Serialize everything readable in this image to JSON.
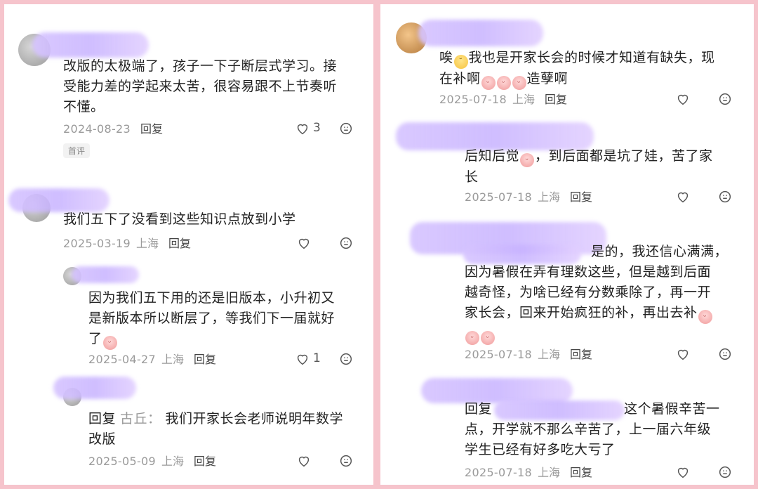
{
  "left": {
    "comments": [
      {
        "text": "改版的太极端了，孩子一下子断层式学习。接受能力差的学起来太苦，很容易跟不上节奏听不懂。",
        "lines": [
          "改版的太极端了，孩子一下子断层式学习。接",
          "受能力差的学起来太苦，很容易跟不上节奏听",
          "不懂。"
        ],
        "date": "2024-08-23",
        "location": "",
        "reply_label": "回复",
        "like_count": "3",
        "badge": "首评"
      },
      {
        "lines": [
          "我们五下了没看到这些知识点放到小学"
        ],
        "date": "2025-03-19",
        "location": "上海",
        "reply_label": "回复",
        "like_count": ""
      },
      {
        "lines": [
          "因为我们五下用的还是旧版本，小升初又",
          "是新版本所以断层了，等我们下一届就好",
          "了"
        ],
        "date": "2025-04-27",
        "location": "上海",
        "reply_label": "回复",
        "like_count": "1"
      },
      {
        "reply_prefix": "回复",
        "reply_to": "古丘：",
        "lines": [
          "我们开家长会老师说明年数学",
          "改版"
        ],
        "date": "2025-05-09",
        "location": "上海",
        "reply_label": "回复",
        "like_count": ""
      }
    ]
  },
  "right": {
    "comments": [
      {
        "line1_pre": "唉",
        "line1_post": "我也是开家长会的时候才知道有缺失，现",
        "line2_pre": "在补啊",
        "line2_post": "造孽啊",
        "date": "2025-07-18",
        "location": "上海",
        "reply_label": "回复"
      },
      {
        "line1_pre": "后知后觉",
        "line1_post": "，到后面都是坑了娃，苦了家",
        "line2": "长",
        "date": "2025-07-18",
        "location": "上海",
        "reply_label": "回复"
      },
      {
        "line1": "是的，我还信心满满，",
        "lines": [
          "因为暑假在弄有理数这些，但是越到后面",
          "越奇怪，为啥已经有分数乘除了，再一开"
        ],
        "line4": "家长会，回来开始疯狂的补，再出去补",
        "date": "2025-07-18",
        "location": "上海",
        "reply_label": "回复"
      },
      {
        "reply_prefix": "回复",
        "line1": "这个暑假辛苦一",
        "lines": [
          "点，开学就不那么辛苦了，上一届六年级",
          "学生已经有好多吃大亏了"
        ],
        "date": "2025-07-18",
        "location": "上海",
        "reply_label": "回复"
      }
    ]
  }
}
